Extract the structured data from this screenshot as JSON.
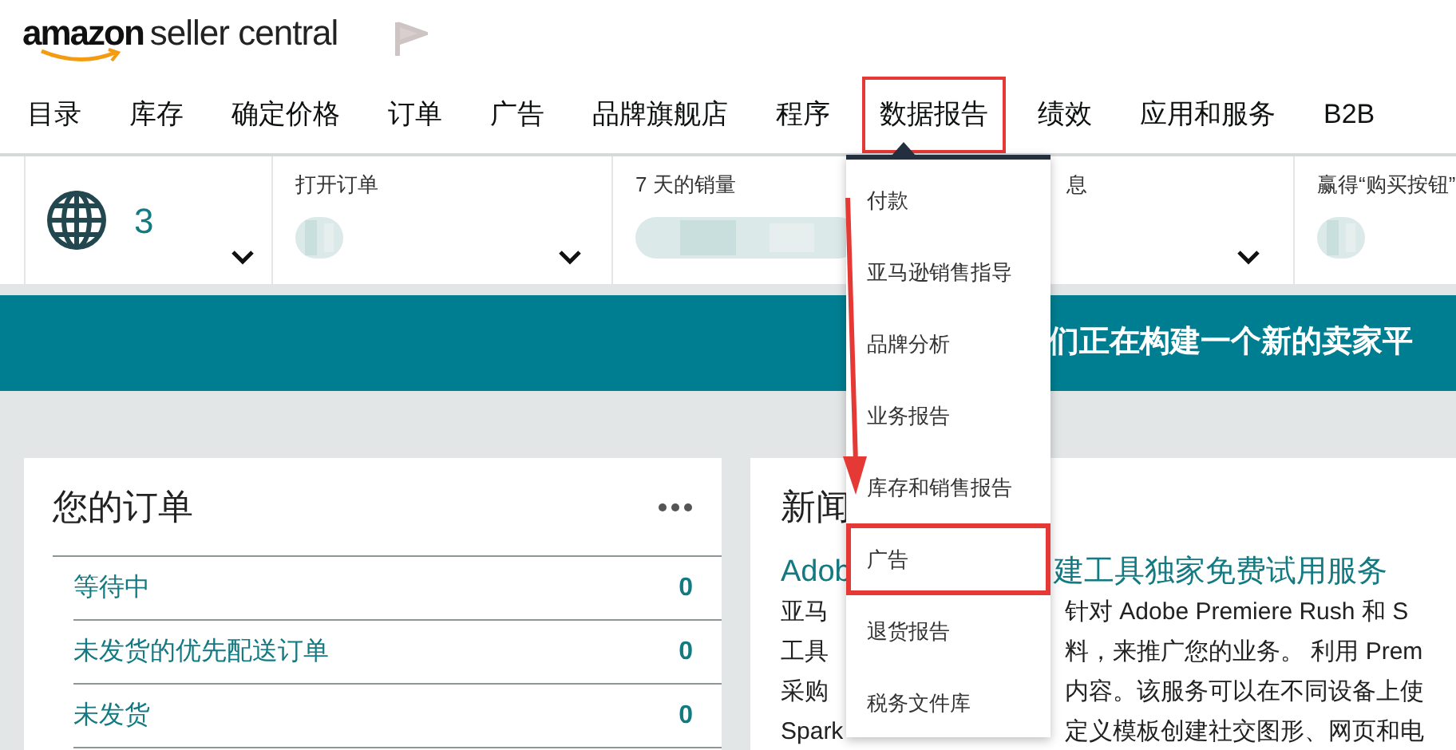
{
  "logo": {
    "brand": "amazon",
    "product": "seller central"
  },
  "nav": [
    {
      "label": "目录",
      "selected": false
    },
    {
      "label": "库存",
      "selected": false
    },
    {
      "label": "确定价格",
      "selected": false
    },
    {
      "label": "订单",
      "selected": false
    },
    {
      "label": "广告",
      "selected": false
    },
    {
      "label": "品牌旗舰店",
      "selected": false
    },
    {
      "label": "程序",
      "selected": false
    },
    {
      "label": "数据报告",
      "selected": true
    },
    {
      "label": "绩效",
      "selected": false
    },
    {
      "label": "应用和服务",
      "selected": false
    },
    {
      "label": "B2B",
      "selected": false
    }
  ],
  "metrics": [
    {
      "kind": "globe",
      "value": "3"
    },
    {
      "kind": "blurred",
      "label": "打开订单"
    },
    {
      "kind": "blurred",
      "label": "7 天的销量"
    },
    {
      "kind": "hidden",
      "label": "息"
    },
    {
      "kind": "blurred",
      "label": "赢得“购买按钮”"
    }
  ],
  "banner": {
    "text": "们正在构建一个新的卖家平"
  },
  "orders": {
    "title": "您的订单",
    "rows": [
      {
        "label": "等待中",
        "count": "0"
      },
      {
        "label": "未发货的优先配送订单",
        "count": "0"
      },
      {
        "label": "未发货",
        "count": "0"
      }
    ]
  },
  "news": {
    "title": "新闻",
    "headline": {
      "left": "Adob",
      "right": "建工具独家免费试用服务"
    },
    "lines": [
      {
        "left": "亚马",
        "right": "针对 Adobe Premiere Rush 和 S"
      },
      {
        "left": "工具",
        "right": "料，来推广您的业务。 利用 Prem"
      },
      {
        "left": "采购",
        "right": "内容。该服务可以在不同设备上使"
      },
      {
        "left": "Spark",
        "right": "定义模板创建社交图形、网页和电"
      }
    ]
  },
  "dropdown": [
    {
      "label": "付款",
      "highlighted": false
    },
    {
      "label": "亚马逊销售指导",
      "highlighted": false
    },
    {
      "label": "品牌分析",
      "highlighted": false
    },
    {
      "label": "业务报告",
      "highlighted": false
    },
    {
      "label": "库存和销售报告",
      "highlighted": false
    },
    {
      "label": "广告",
      "highlighted": true
    },
    {
      "label": "退货报告",
      "highlighted": false
    },
    {
      "label": "税务文件库",
      "highlighted": false
    }
  ]
}
